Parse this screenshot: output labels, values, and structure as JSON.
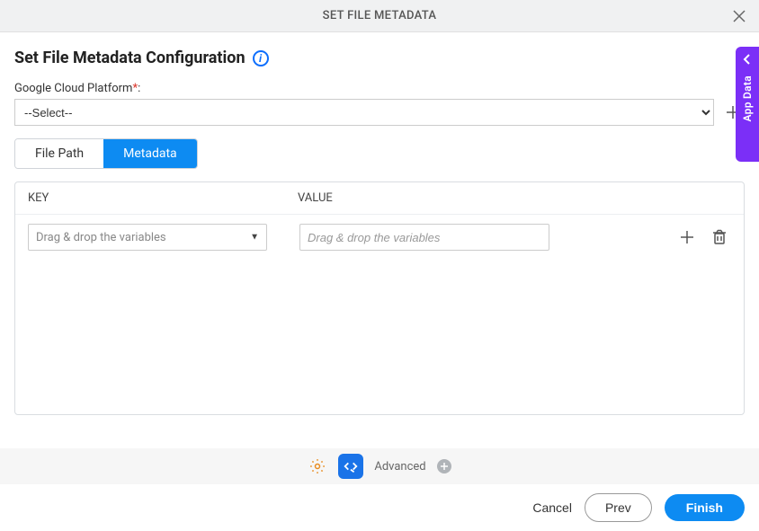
{
  "topbar": {
    "title": "SET FILE METADATA"
  },
  "page": {
    "title": "Set File Metadata Configuration"
  },
  "gcp": {
    "label": "Google Cloud Platform",
    "required_marker": "*",
    "colon": ":",
    "selected": "--Select--"
  },
  "tabs": {
    "file_path": "File Path",
    "metadata": "Metadata"
  },
  "panel": {
    "headers": {
      "key": "KEY",
      "value": "VALUE"
    },
    "row": {
      "key_placeholder": "Drag & drop the variables",
      "value_placeholder": "Drag & drop the variables"
    }
  },
  "bottombar": {
    "advanced": "Advanced"
  },
  "footer": {
    "cancel": "Cancel",
    "prev": "Prev",
    "finish": "Finish"
  },
  "sidetab": {
    "label": "App Data"
  }
}
